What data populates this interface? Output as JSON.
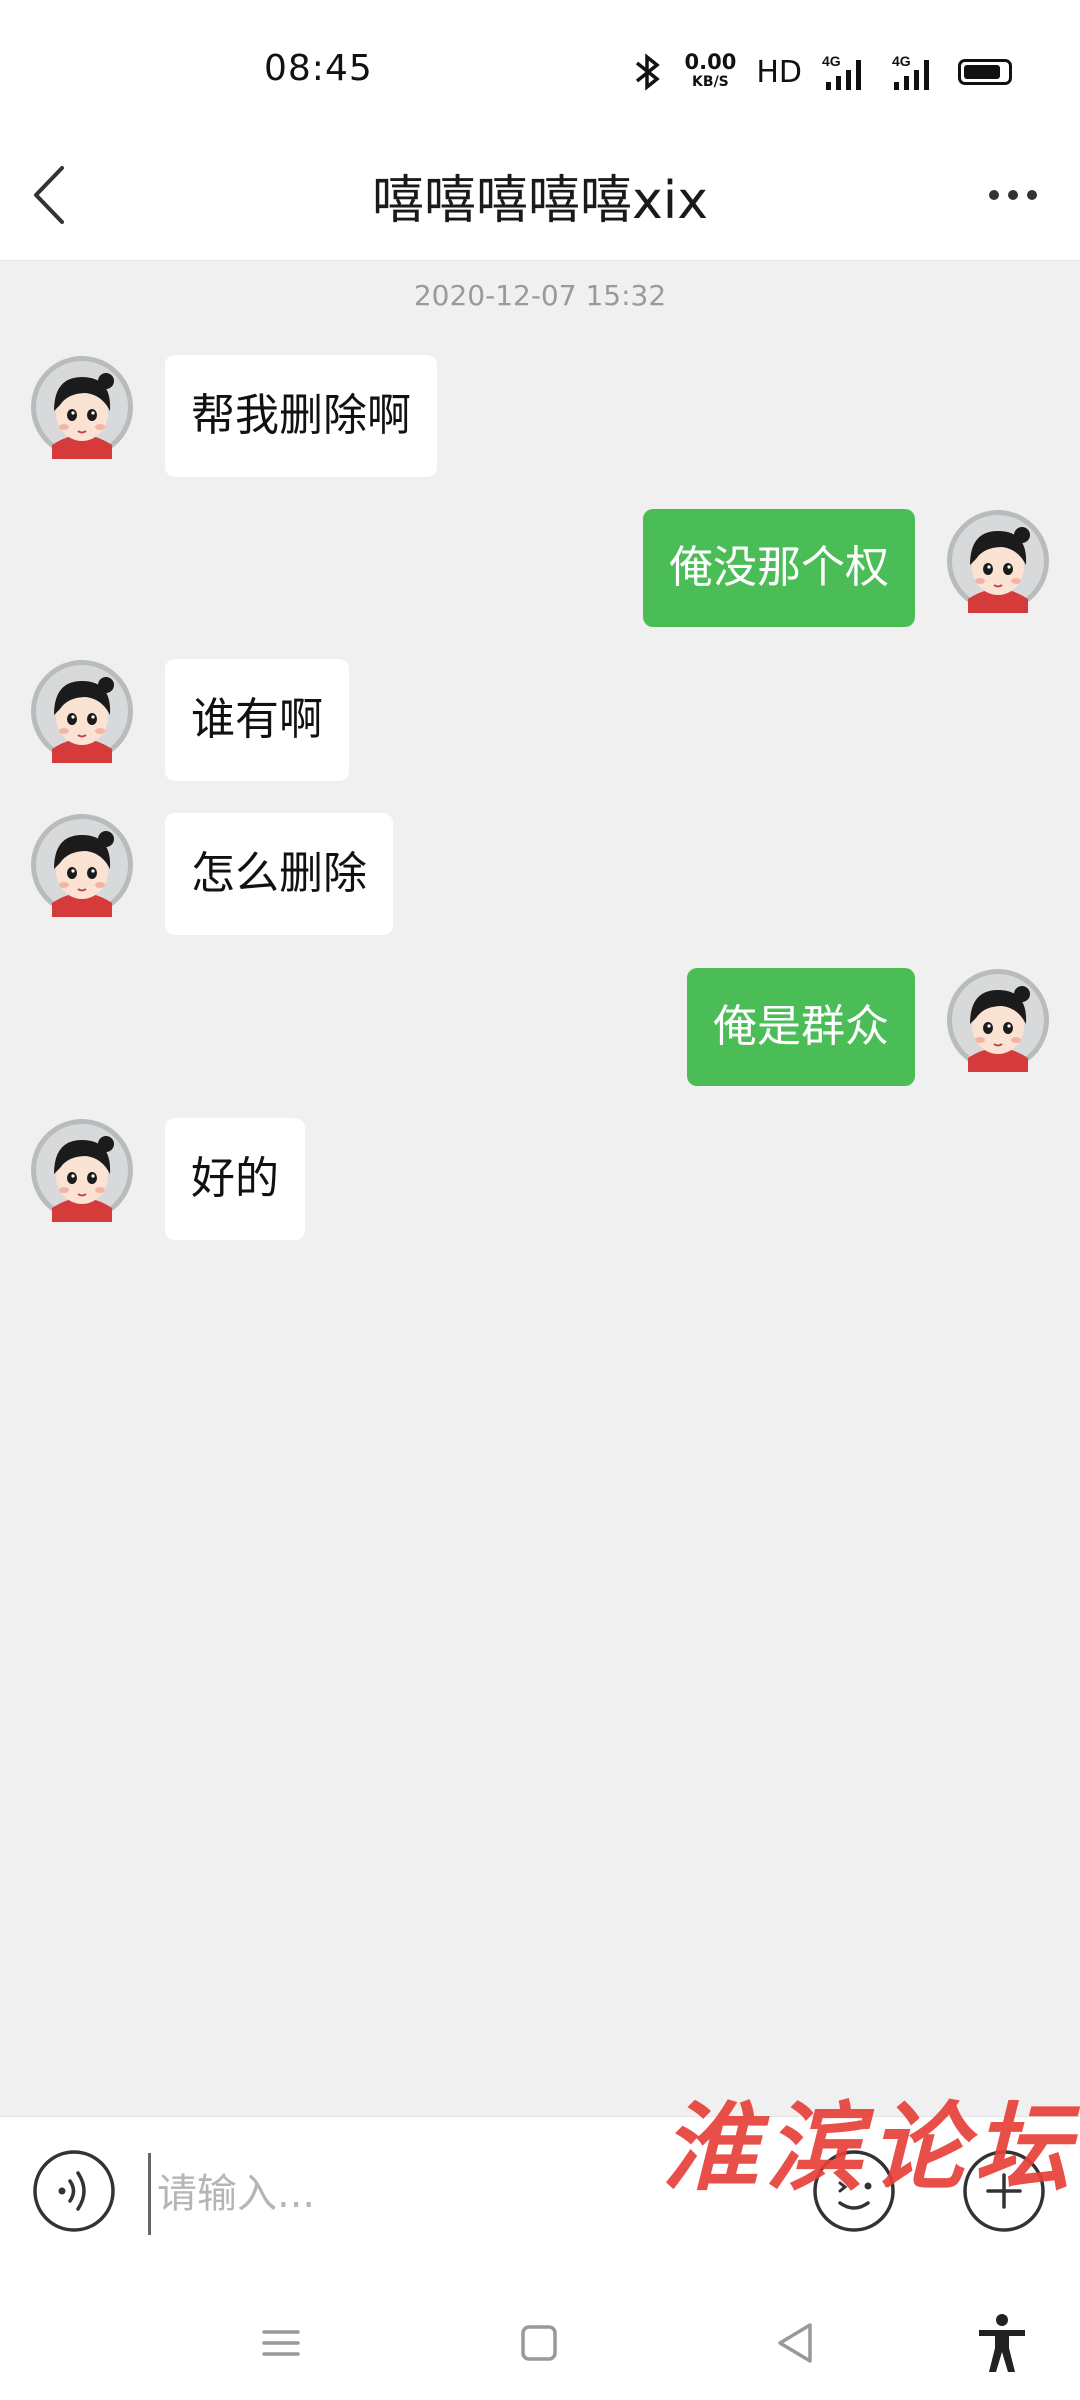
{
  "status_bar": {
    "time": "08:45",
    "net_speed": "0.00",
    "net_unit": "KB/S",
    "hd": "HD",
    "icons": [
      "bluetooth-icon",
      "signal-4g-icon",
      "signal-4g-icon",
      "battery-icon"
    ]
  },
  "header": {
    "title": "嘻嘻嘻嘻嘻xix",
    "back_icon": "chevron-left-icon",
    "more_icon": "more-dots-icon"
  },
  "chat": {
    "timestamp": "2020-12-07 15:32",
    "messages": [
      {
        "direction": "received",
        "text": "帮我删除啊"
      },
      {
        "direction": "sent",
        "text": "俺没那个权"
      },
      {
        "direction": "received",
        "text": "谁有啊"
      },
      {
        "direction": "received",
        "text": "怎么删除"
      },
      {
        "direction": "sent",
        "text": "俺是群众"
      },
      {
        "direction": "received",
        "text": "好的"
      }
    ]
  },
  "input_bar": {
    "placeholder": "请输入...",
    "value": "",
    "icons": [
      "voice-icon",
      "emoji-icon",
      "plus-icon"
    ]
  },
  "watermark": "淮滨论坛",
  "nav_bar": {
    "icons": [
      "menu-icon",
      "home-icon",
      "back-triangle-icon",
      "accessibility-icon"
    ]
  },
  "colors": {
    "sent_bubble": "#4bbd57",
    "received_bubble": "#ffffff",
    "chat_background": "#f0f0f0",
    "watermark": "#e8413a"
  }
}
